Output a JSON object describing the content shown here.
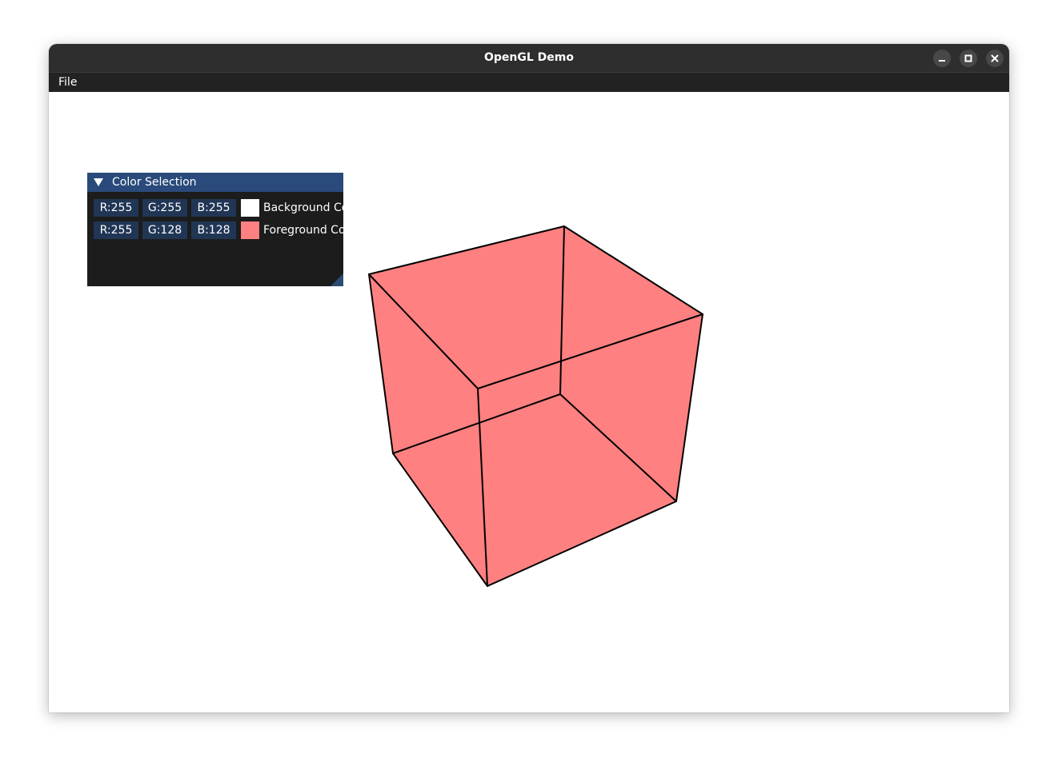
{
  "window": {
    "title": "OpenGL Demo",
    "controls": [
      "minimize-icon",
      "maximize-icon",
      "close-icon"
    ]
  },
  "menubar": {
    "items": [
      {
        "label": "File"
      }
    ]
  },
  "color_panel": {
    "title": "Color Selection",
    "rows": [
      {
        "r": "R:255",
        "g": "G:255",
        "b": "B:255",
        "swatch": "#ffffff",
        "label": "Background Color"
      },
      {
        "r": "R:255",
        "g": "G:128",
        "b": "B:128",
        "swatch": "#ff8080",
        "label": "Foreground Color"
      }
    ]
  },
  "scene": {
    "background_color": "#ffffff",
    "cube_color": "#ff8080",
    "edge_color": "#000000"
  },
  "colors": {
    "titlebar": "#2e2e2e",
    "menubar": "#222222",
    "panel_bg": "#1c1c1c",
    "panel_header": "#294a7a",
    "field_bg": "#213655"
  }
}
